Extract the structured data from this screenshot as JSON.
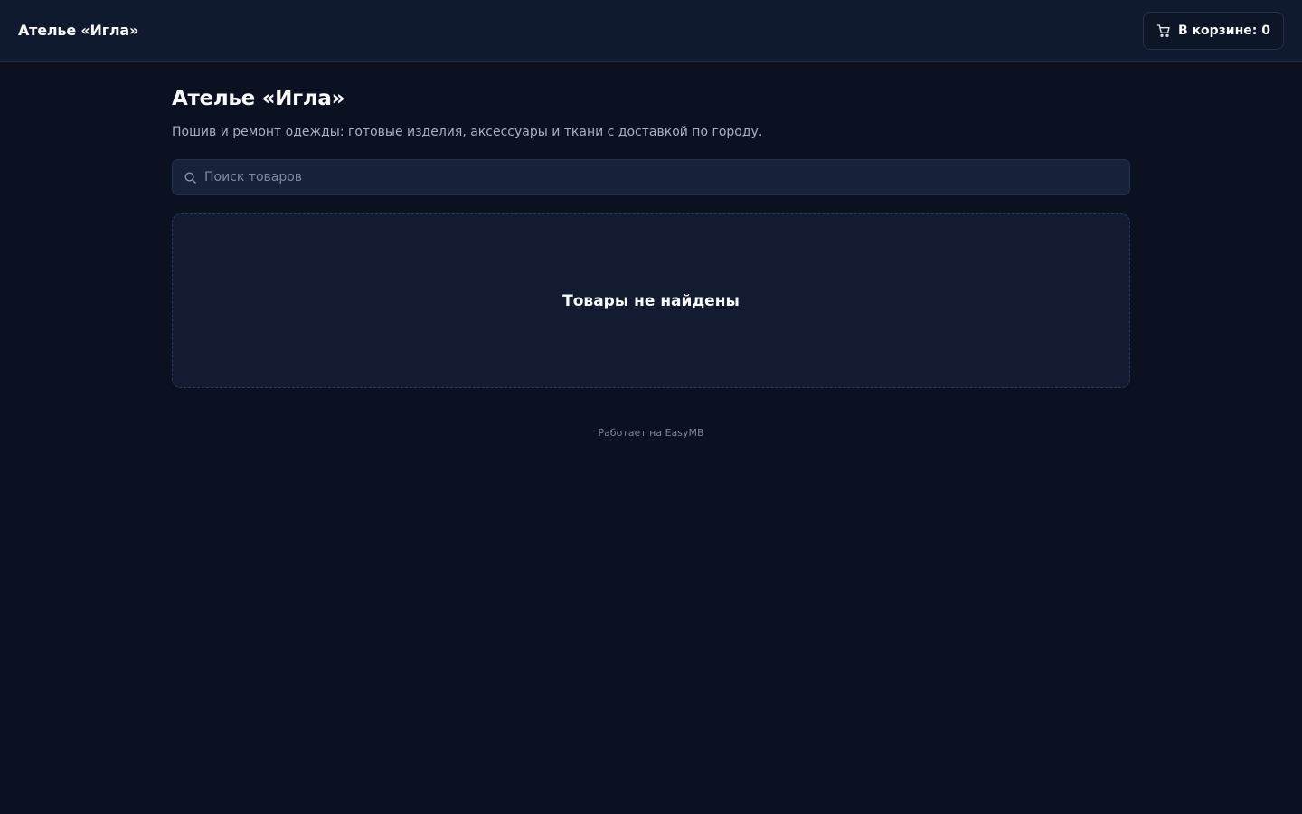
{
  "header": {
    "brand": "Ателье «Игла»",
    "cart_label": "В корзине: 0"
  },
  "main": {
    "title": "Ателье «Игла»",
    "subtitle": "Пошив и ремонт одежды: готовые изделия, аксессуары и ткани с доставкой по городу.",
    "search": {
      "placeholder": "Поиск товаров",
      "value": ""
    },
    "empty_message": "Товары не найдены"
  },
  "footer": {
    "text": "Работает на EasyMB"
  },
  "icons": {
    "cart": "cart-icon",
    "search": "search-icon"
  },
  "colors": {
    "background": "#0b1120",
    "header": "#101a2e",
    "surface": "#121b30",
    "input": "#17223a",
    "border": "#24314d",
    "text_primary": "#f8fafc",
    "text_secondary": "#a7b1c2",
    "text_muted": "#7a8599"
  }
}
